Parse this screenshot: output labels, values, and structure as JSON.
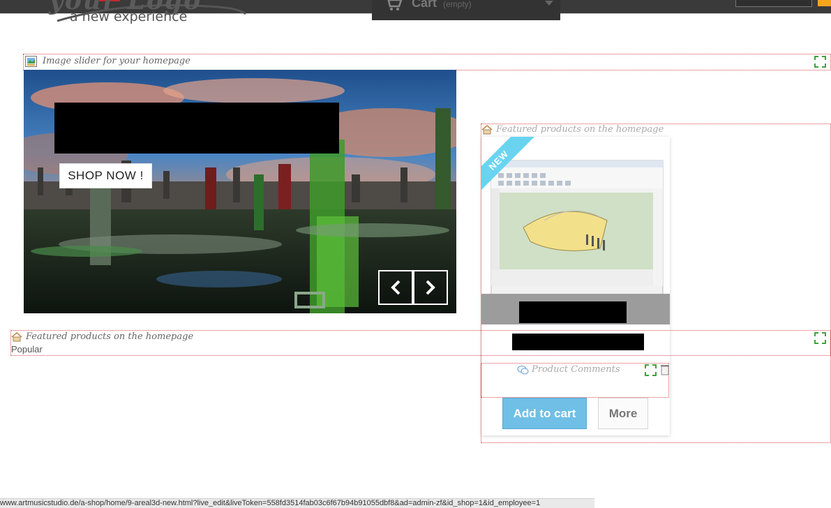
{
  "header": {
    "logo_script": "your Logo",
    "logo_tagline": "a new experience",
    "cart_label": "Cart",
    "cart_status": "(empty)"
  },
  "hooks": {
    "slider_title": "Image slider for your homepage",
    "featured_title_top": "Featured products on the homepage",
    "featured_title_bottom": "Featured products on the homepage",
    "comments_title": "Product Comments"
  },
  "slider": {
    "cta_label": "SHOP NOW !",
    "prev_icon": "chevron-left-icon",
    "next_icon": "chevron-right-icon"
  },
  "product": {
    "badge": "NEW",
    "add_to_cart_label": "Add to cart",
    "more_label": "More"
  },
  "tabs": {
    "popular_label": "Popular"
  },
  "statusbar": {
    "url": "www.artmusicstudio.de/a-shop/home/9-areal3d-new.html?live_edit&liveToken=558fd3514fab03c6f67b94b91055dbf8&ad=admin-zf&id_shop=1&id_employee=1"
  },
  "colors": {
    "add_to_cart": "#6fbfe6",
    "new_ribbon": "#6ad4f0",
    "hook_border": "#d9474f",
    "cart_bar": "#333333",
    "accent_orange": "#f4a51c"
  }
}
